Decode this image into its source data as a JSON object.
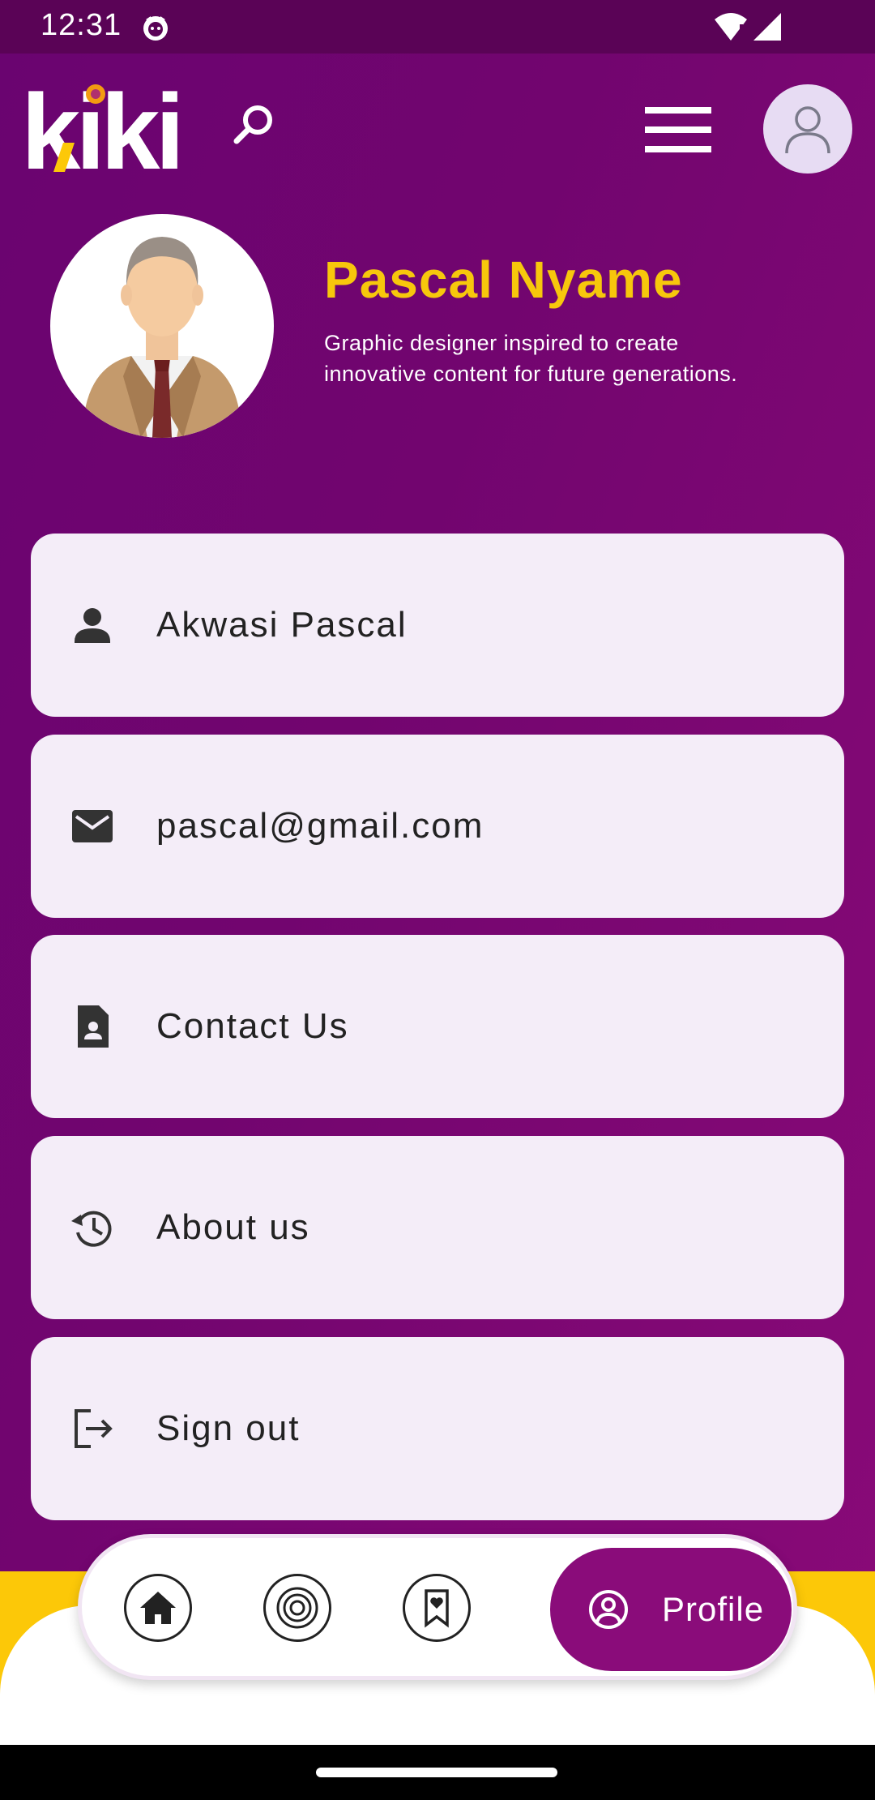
{
  "status_bar": {
    "time": "12:31"
  },
  "header": {
    "logo": "kiki",
    "icons": {
      "search": "search-icon",
      "menu": "hamburger-menu-icon",
      "avatar": "user-avatar-icon"
    }
  },
  "profile": {
    "name": "Pascal Nyame",
    "bio": "Graphic designer  inspired to create\n innovative content for future generations."
  },
  "cards": [
    {
      "label": "Akwasi Pascal",
      "icon": "person-icon"
    },
    {
      "label": "pascal@gmail.com",
      "icon": "mail-icon"
    },
    {
      "label": "Contact Us",
      "icon": "contact-document-icon"
    },
    {
      "label": "About us",
      "icon": "history-icon"
    },
    {
      "label": "Sign out",
      "icon": "logout-icon"
    }
  ],
  "bottom_nav": {
    "items": [
      {
        "icon": "home-icon"
      },
      {
        "icon": "target-icon"
      },
      {
        "icon": "bookmark-heart-icon"
      }
    ],
    "active": {
      "label": "Profile",
      "icon": "profile-icon"
    }
  },
  "colors": {
    "accent_yellow": "#f7c70c",
    "purple": "#8a0c7a",
    "card_bg": "#f4edf8"
  }
}
